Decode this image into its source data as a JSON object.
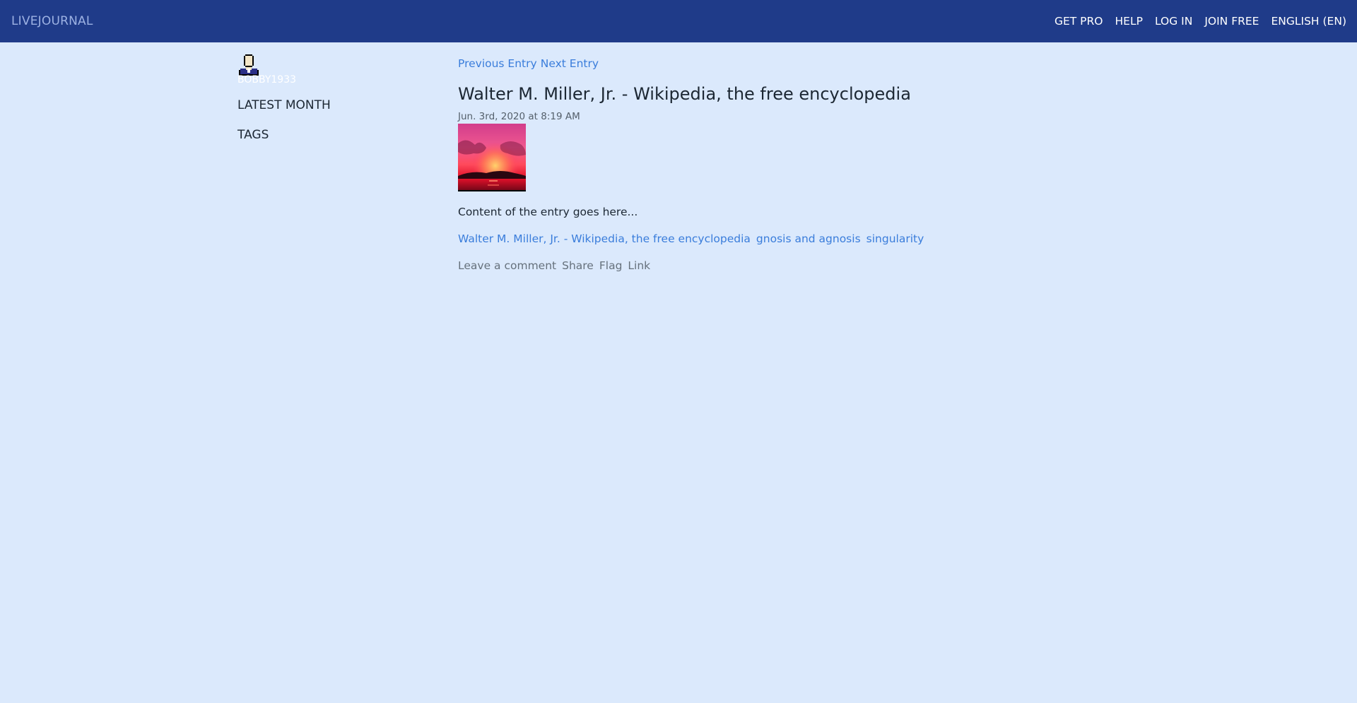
{
  "header": {
    "brand": "LIVEJOURNAL",
    "nav": [
      {
        "label": "GET PRO",
        "name": "get-pro-link"
      },
      {
        "label": "HELP",
        "name": "help-link"
      },
      {
        "label": "LOG IN",
        "name": "log-in-link"
      },
      {
        "label": "JOIN FREE",
        "name": "join-free-link"
      },
      {
        "label": "ENGLISH (EN)",
        "name": "language-selector"
      }
    ]
  },
  "sidebar": {
    "avatar_icon": "user-avatar-icon",
    "username": "BOBBY1933",
    "items": [
      {
        "label": "LATEST MONTH"
      },
      {
        "label": "TAGS"
      }
    ]
  },
  "entry": {
    "prev_label": "Previous Entry",
    "next_label": "Next Entry",
    "title": "Walter M. Miller, Jr. - Wikipedia, the free encyclopedia",
    "date": "Jun. 3rd, 2020 at 8:19 AM",
    "image_icon": "sunset-image",
    "content": "Content of the entry goes here...",
    "tags": [
      "Walter M. Miller, Jr. - Wikipedia, the free encyclopedia",
      "gnosis and agnosis",
      "singularity"
    ],
    "actions": [
      "Leave a comment",
      "Share",
      "Flag",
      "Link"
    ]
  },
  "colors": {
    "header_bg": "#1f3b89",
    "page_bg": "#dbe9fc",
    "link": "#3a7ddb",
    "muted": "#66717c"
  }
}
